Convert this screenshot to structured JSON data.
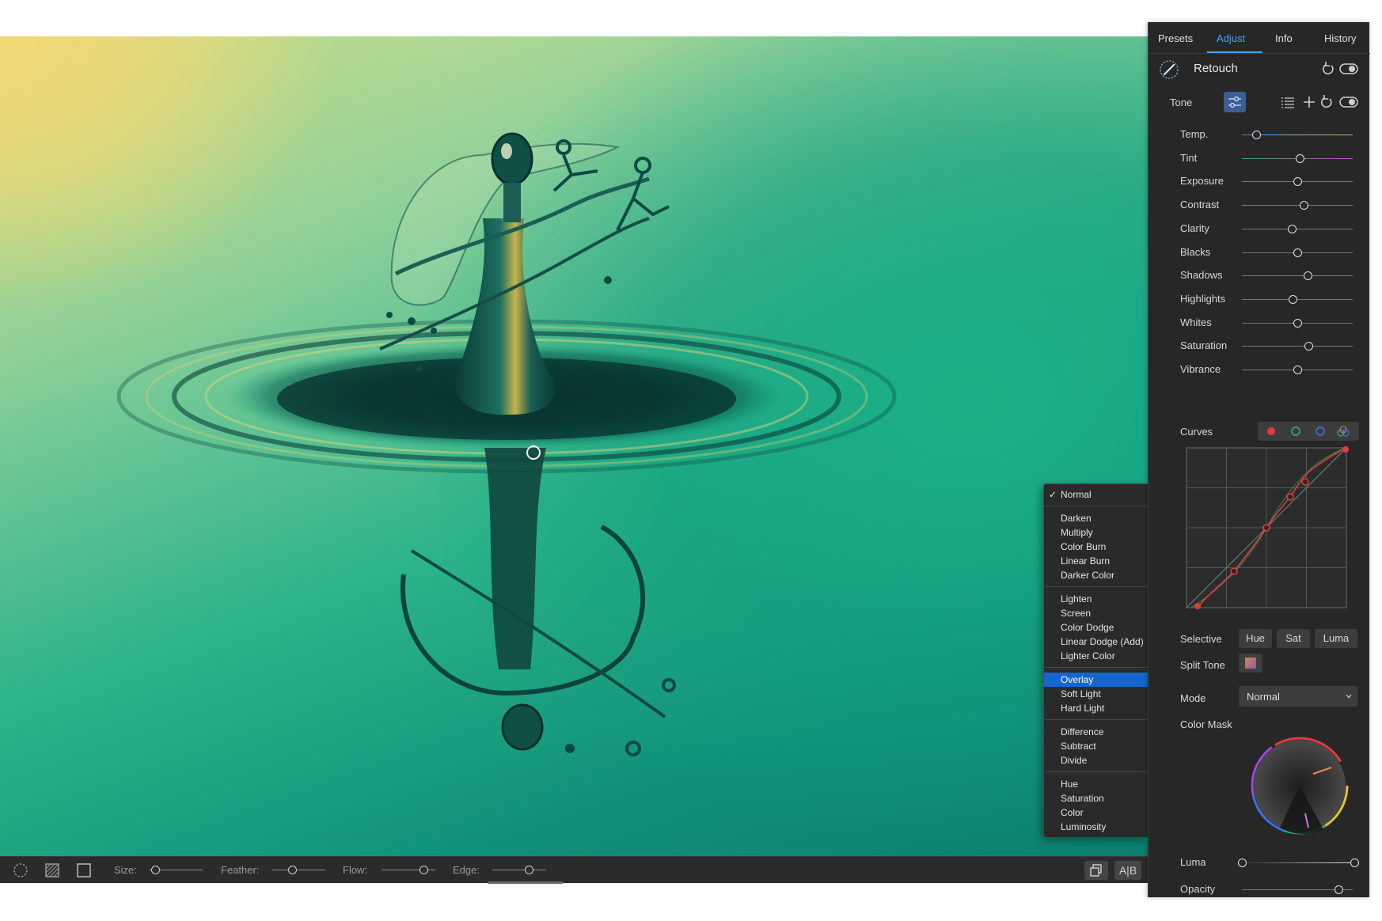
{
  "canvas": {
    "blend_menu": {
      "groups": [
        [
          {
            "label": "Normal",
            "checked": true
          }
        ],
        [
          {
            "label": "Darken"
          },
          {
            "label": "Multiply"
          },
          {
            "label": "Color Burn"
          },
          {
            "label": "Linear Burn"
          },
          {
            "label": "Darker Color"
          }
        ],
        [
          {
            "label": "Lighten"
          },
          {
            "label": "Screen"
          },
          {
            "label": "Color Dodge"
          },
          {
            "label": "Linear Dodge (Add)"
          },
          {
            "label": "Lighter Color"
          }
        ],
        [
          {
            "label": "Overlay",
            "highlighted": true
          },
          {
            "label": "Soft Light"
          },
          {
            "label": "Hard Light"
          }
        ],
        [
          {
            "label": "Difference"
          },
          {
            "label": "Subtract"
          },
          {
            "label": "Divide"
          }
        ],
        [
          {
            "label": "Hue"
          },
          {
            "label": "Saturation"
          },
          {
            "label": "Color"
          },
          {
            "label": "Luminosity"
          }
        ]
      ],
      "checkmark": "✓",
      "highlight_color": "#1566d1"
    }
  },
  "toolbar": {
    "tools": [
      "brush-circle-icon",
      "hatch-fill-icon",
      "square-mask-icon"
    ],
    "size_label": "Size:",
    "feather_label": "Feather:",
    "flow_label": "Flow:",
    "edge_label": "Edge:",
    "size_value": 0.12,
    "feather_value": 0.38,
    "flow_value": 0.78,
    "edge_value": 0.68,
    "compare_label": "A|B"
  },
  "panel": {
    "tabs": [
      {
        "label": "Presets",
        "active": false
      },
      {
        "label": "Adjust",
        "active": true
      },
      {
        "label": "Info",
        "active": false
      },
      {
        "label": "History",
        "active": false
      }
    ],
    "accent_color": "#4aa3ff",
    "tool_title": "Retouch",
    "section_label": "Tone",
    "sliders": [
      {
        "label": "Temp.",
        "value": 0.13,
        "style": "temp"
      },
      {
        "label": "Tint",
        "value": 0.52,
        "style": "tint"
      },
      {
        "label": "Exposure",
        "value": 0.5
      },
      {
        "label": "Contrast",
        "value": 0.56
      },
      {
        "label": "Clarity",
        "value": 0.45
      },
      {
        "label": "Blacks",
        "value": 0.5
      },
      {
        "label": "Shadows",
        "value": 0.59
      },
      {
        "label": "Highlights",
        "value": 0.46
      },
      {
        "label": "Whites",
        "value": 0.5
      },
      {
        "label": "Saturation",
        "value": 0.6
      },
      {
        "label": "Vibrance",
        "value": 0.5
      }
    ],
    "curves_label": "Curves",
    "curve_channel_colors": [
      "#e23b3b",
      "#33b066",
      "#3b6fe2",
      "#d96a55"
    ],
    "selective_label": "Selective",
    "selective_buttons": [
      "Hue",
      "Sat",
      "Luma"
    ],
    "split_tone_label": "Split Tone",
    "mode_label": "Mode",
    "mode_value": "Normal",
    "color_mask_label": "Color Mask",
    "luma_label": "Luma",
    "luma_range": [
      0.0,
      1.0
    ],
    "opacity_label": "Opacity",
    "opacity_value": 0.87
  }
}
